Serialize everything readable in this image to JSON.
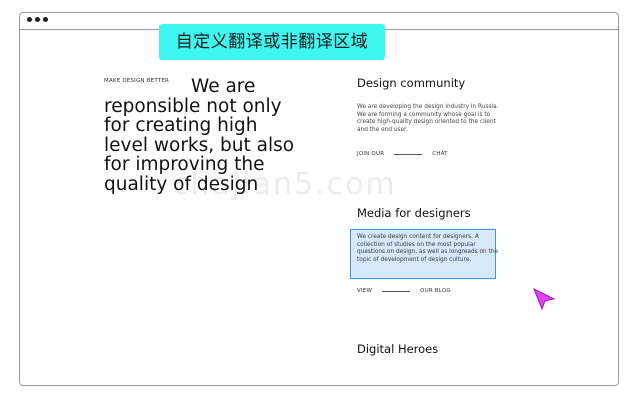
{
  "overlay": {
    "banner_text": "自定义翻译或非翻译区域"
  },
  "hero": {
    "kicker": "MAKE DESIGN BETTER",
    "line1": "We are",
    "line2": "reponsible not only",
    "line3": "for creating high",
    "line4": "level works, but also",
    "line5": "for improving the",
    "line6": "quality of design"
  },
  "sections": [
    {
      "title": "Design community",
      "body": "We are developing the design industry in Russia. We are forming a community whose goal is to create high-quality design oriented to the client and the end user.",
      "link_left": "JOIN OUR",
      "link_right": "CHAT"
    },
    {
      "title": "Media for designers",
      "body": "We create design content for designers. A collection of studies on the most popular questions on design, as well as longreads on the topic of development of design culture.",
      "link_left": "VIEW",
      "link_right": "OUR BLOG"
    },
    {
      "title": "Digital Heroes"
    }
  ],
  "watermark_text": "chajian5.com",
  "colors": {
    "banner_bg": "#3ff5f0",
    "highlight_bg": "#d6e9fb",
    "highlight_border": "#4a8fe0",
    "cursor": "#e040fb"
  },
  "icons": {
    "cursor": "pointer-arrow-icon",
    "window_controls": "window-dots-icon"
  }
}
